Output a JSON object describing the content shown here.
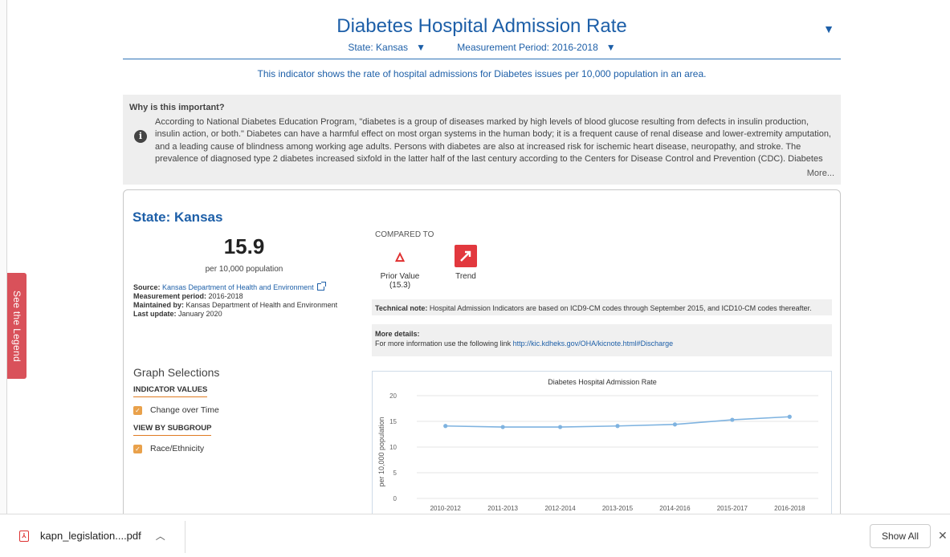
{
  "legend_tab": "See the Legend",
  "header": {
    "title": "Diabetes Hospital Admission Rate",
    "state_filter": "State: Kansas",
    "period_filter": "Measurement Period: 2016-2018"
  },
  "description": "This indicator shows the rate of hospital admissions for Diabetes issues per 10,000 population in an area.",
  "why": {
    "title": "Why is this important?",
    "text": "According to National Diabetes Education Program, \"diabetes is a group of diseases marked by high levels of blood glucose resulting from defects in insulin production, insulin action, or both.\" Diabetes can have a harmful effect on most organ systems in the human body; it is a frequent cause of renal disease and lower-extremity amputation, and a leading cause of blindness among working age adults. Persons with diabetes are also at increased risk for ischemic heart disease, neuropathy, and stroke. The prevalence of diagnosed type 2 diabetes increased sixfold in the latter half of the last century according to the Centers for Disease Control and Prevention (CDC). Diabetes risk factors such as obesity and physical inactivity have",
    "more": "More..."
  },
  "card": {
    "state_title": "State: Kansas",
    "value": "15.9",
    "unit": "per 10,000 population",
    "source_label": "Source:",
    "source_link": "Kansas Department of Health and Environment",
    "period_label": "Measurement period:",
    "period_value": "2016-2018",
    "maintained_label": "Maintained by:",
    "maintained_value": "Kansas Department of Health and Environment",
    "update_label": "Last update:",
    "update_value": "January 2020",
    "graph_selections": "Graph Selections",
    "indicator_values": "INDICATOR VALUES",
    "change_over_time": "Change over Time",
    "view_by_subgroup": "VIEW BY SUBGROUP",
    "race_ethnicity": "Race/Ethnicity",
    "compared_to": "COMPARED TO",
    "prior_value_label": "Prior Value",
    "prior_value": "(15.3)",
    "trend_label": "Trend",
    "tech_note_label": "Technical note:",
    "tech_note": "Hospital Admission Indicators are based on ICD9-CM codes through September 2015, and ICD10-CM codes thereafter.",
    "more_details_label": "More details:",
    "more_details_text": "For more information use the following link",
    "more_details_link": "http://kic.kdheks.gov/OHA/kicnote.html#Discharge"
  },
  "chart_data": {
    "type": "line",
    "title": "Diabetes Hospital Admission Rate",
    "xlabel": "",
    "ylabel": "per 10,000 population",
    "categories": [
      "2010-2012",
      "2011-2013",
      "2012-2014",
      "2013-2015",
      "2014-2016",
      "2015-2017",
      "2016-2018"
    ],
    "series": [
      {
        "values": [
          14.1,
          13.9,
          13.9,
          14.1,
          14.4,
          15.3,
          15.9
        ]
      }
    ],
    "ylim": [
      0,
      20
    ],
    "yticks": [
      0,
      5,
      10,
      15,
      20
    ],
    "grid": true,
    "color": "#7fb3e0"
  },
  "downloads": {
    "file_name": "kapn_legislation....pdf",
    "show_all": "Show All"
  }
}
